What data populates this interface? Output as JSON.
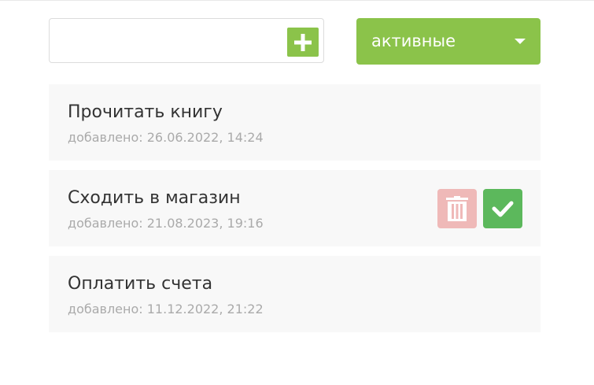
{
  "new_task": {
    "value": "",
    "add_icon": "plus-icon"
  },
  "filter": {
    "selected": "активные",
    "caret_icon": "caret-down-icon"
  },
  "tasks": [
    {
      "title": "Прочитать книгу",
      "date": "добавлено: 26.06.2022, 14:24"
    },
    {
      "title": "Сходить в магазин",
      "date": "добавлено: 21.08.2023, 19:16",
      "delete_icon": "trash-icon",
      "done_icon": "check-icon"
    },
    {
      "title": "Оплатить счета",
      "date": "добавлено: 11.12.2022, 21:22"
    }
  ],
  "colors": {
    "accent": "#8bc34a",
    "delete": "#efb9b8",
    "done": "#5cb85c",
    "task_background": "#f8f8f8",
    "date_text": "#aaaaaa"
  }
}
